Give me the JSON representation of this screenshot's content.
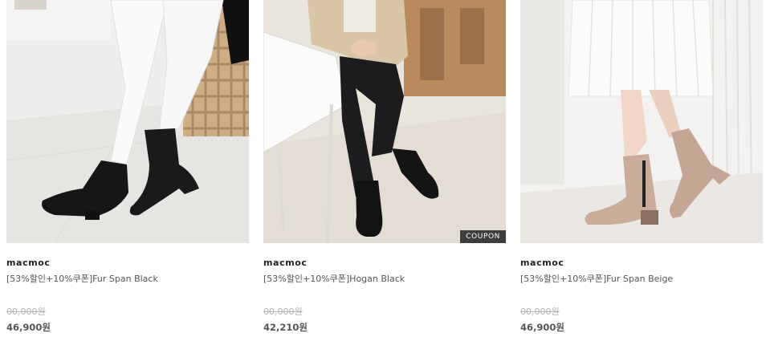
{
  "products": [
    {
      "brand": "macmoc",
      "name": "[53%할인+10%쿠폰]Fur Span Black",
      "original_price": "00,000원",
      "price": "46,900원",
      "coupon": ""
    },
    {
      "brand": "macmoc",
      "name": "[53%할인+10%쿠폰]Hogan Black",
      "original_price": "00,000원",
      "price": "42,210원",
      "coupon": "COUPON"
    },
    {
      "brand": "macmoc",
      "name": "[53%할인+10%쿠폰]Fur Span Beige",
      "original_price": "00,000원",
      "price": "46,900원",
      "coupon": ""
    }
  ]
}
